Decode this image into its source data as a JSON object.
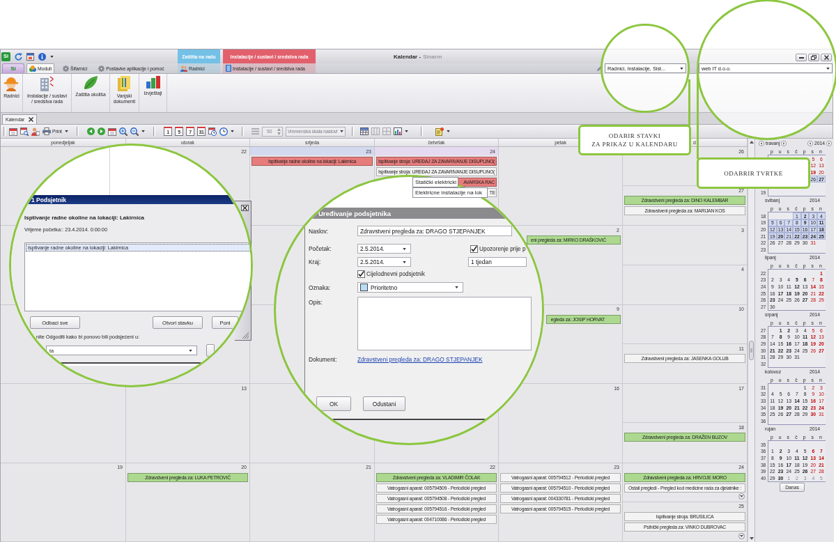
{
  "window": {
    "logo": "Si",
    "title": "Kalendar -",
    "app_name": "Sinarm"
  },
  "context_groups": [
    {
      "label": "Zaštita na radu",
      "color": "#74c0e6",
      "tabs": [
        {
          "label": "Radnici",
          "selected": false
        }
      ]
    },
    {
      "label": "Instalacije / sustavi / sredstva rada",
      "color": "#e2606c",
      "tabs": [
        {
          "label": "Instalacije / sustavi / sredstva rada",
          "selected": false
        }
      ]
    }
  ],
  "app_button": {
    "label": "Si"
  },
  "ribbon_tabs": [
    {
      "label": "Moduli",
      "selected": true
    },
    {
      "label": "Šifarnici",
      "selected": false
    },
    {
      "label": "Postavke aplikacije i pomoć",
      "selected": false
    }
  ],
  "filters": {
    "items": "Radnici, Instalacije, Sist...",
    "company": "web IT d.o.o."
  },
  "ribbon_buttons": [
    {
      "label": "Radnici"
    },
    {
      "label": "Instalacije / sustavi\n/ sredstva rada"
    },
    {
      "label": "Zaštita okoliša"
    },
    {
      "label": "Vanjski\ndokumenti"
    },
    {
      "label": "Izvještaji"
    }
  ],
  "document_tabs": [
    {
      "label": "Kalendar",
      "selected": true
    }
  ],
  "toolbar": {
    "print": "Print",
    "views": [
      "1",
      "5",
      "7",
      "31"
    ],
    "spin": {
      "value": "50",
      "disabled": true
    },
    "time_scale": {
      "value": "Vremenska skala naslovi",
      "disabled": true
    }
  },
  "calendar": {
    "columns": [
      "ponedjeljak",
      "utorak",
      "srijeda",
      "četvrtak",
      "petak",
      "d"
    ],
    "weeks": [
      {
        "tue": {
          "date": "22",
          "selected": false,
          "today": false,
          "more": false
        },
        "wed": {
          "date": "23",
          "selected": true,
          "today": false,
          "more": false,
          "events": [
            {
              "title": "Ispitivanje radne okoline na lokaciji: Lakirnica",
              "color": "#e77c7c"
            }
          ]
        },
        "thu": {
          "date": "24",
          "selected": false,
          "today": true,
          "more": false,
          "events": [
            {
              "title": "Ispitivanje stroja: UREĐAJ ZA ZAVARIVANJE DISUPLINO(",
              "color": "#e77c7c"
            },
            {
              "title": "Ispitivanje stroja: UREĐAJ ZA ZAVARIVANJE DISUPLINO(",
              "color": "#f3f3f3"
            },
            {
              "title": "AVARSKA RAC",
              "color": "#e77c7c"
            },
            {
              "title": "TE",
              "color": "#f3f3f3"
            }
          ]
        },
        "sat": {
          "date": "26",
          "selected": false,
          "today": false,
          "more": false
        },
        "sun": {
          "date": "27",
          "selected": false,
          "today": false,
          "more": false,
          "events": [
            {
              "title": "Zdravstveni pregleda za: DINO KALEMBAR",
              "color": "#acd98f"
            },
            {
              "title": "Zdravstveni pregleda za: MARIJAN KOS",
              "color": "#f3f3f3"
            }
          ]
        }
      },
      {
        "fri": {
          "date": "2",
          "selected": false,
          "today": false,
          "more": false,
          "events": [
            {
              "title": "eni pregleda za: MIRKO DRAŠKOVIĆ",
              "color": "#acd98f"
            }
          ]
        },
        "sat": {
          "date": "3",
          "selected": false,
          "today": false,
          "more": false
        },
        "sun": {
          "date": "4",
          "selected": false,
          "today": false,
          "more": false
        }
      },
      {
        "fri": {
          "date": "9",
          "selected": false,
          "today": false,
          "more": false,
          "events": [
            {
              "title": "egleda za: JOSIP HORVAT",
              "color": "#acd98f"
            }
          ]
        },
        "sat": {
          "date": "10",
          "selected": false,
          "today": false,
          "more": false
        },
        "sun": {
          "date": "11",
          "selected": false,
          "today": false,
          "more": false,
          "events": [
            {
              "title": "Zdravstveni pregleda za: JASENKA GOLUB",
              "color": "#f3f3f3"
            }
          ]
        }
      },
      {
        "tue": {
          "date": "13",
          "selected": false,
          "today": false,
          "more": false
        },
        "fri": {
          "date": "16",
          "selected": false,
          "today": false,
          "more": false
        },
        "sat": {
          "date": "17",
          "selected": false,
          "today": false,
          "more": false
        },
        "sun": {
          "date": "18",
          "selected": false,
          "today": false,
          "more": false,
          "events": [
            {
              "title": "Zdravstveni pregleda za: DRAŽEN BUZOV",
              "color": "#acd98f"
            }
          ]
        }
      },
      {
        "mon": {
          "date": "19",
          "selected": false,
          "today": false,
          "more": false
        },
        "tue": {
          "date": "20",
          "selected": false,
          "today": false,
          "more": false,
          "events": [
            {
              "title": "Zdravstveni pregleda za: LUKA PETROVIĆ",
              "color": "#acd98f"
            }
          ]
        },
        "wed": {
          "date": "21",
          "selected": false,
          "today": false,
          "more": false
        },
        "thu": {
          "date": "22",
          "selected": false,
          "today": false,
          "more": false,
          "events": [
            {
              "title": "Zdravstveni pregleda za: VLADIMIR ČOLAK",
              "color": "#acd98f"
            },
            {
              "title": "Vatrogasni aparat: 005794509 - Periodicki pregled",
              "color": "#f3f3f3"
            },
            {
              "title": "Vatrogasni aparat: 005794508 - Periodicki pregled",
              "color": "#f3f3f3"
            },
            {
              "title": "Vatrogasni aparat: 005794516 - Periodicki pregled",
              "color": "#f3f3f3"
            },
            {
              "title": "Vatrogasni aparat: 004710086 - Periodicki pregled",
              "color": "#f3f3f3"
            }
          ]
        },
        "fri": {
          "date": "23",
          "selected": false,
          "today": false,
          "more": false,
          "events": [
            {
              "title": "Vatrogasni aparat: 005794512 - Periodicki pregled",
              "color": "#f3f3f3"
            },
            {
              "title": "Vatrogasni aparat: 005794510 - Periodicki pregled",
              "color": "#f3f3f3"
            },
            {
              "title": "Vatrogasni aparat: 004330781 - Periodicki pregled",
              "color": "#f3f3f3"
            },
            {
              "title": "Vatrogasni aparat: 005794515 - Periodicki pregled",
              "color": "#f3f3f3"
            }
          ]
        },
        "sat": {
          "date": "24",
          "selected": false,
          "today": false,
          "more": true,
          "events": [
            {
              "title": "Zdravstveni pregleda za: HRVOJE MORO",
              "color": "#acd98f"
            },
            {
              "title": "Ostali pregledi - Pregled kod medicine rada za djelatnike :",
              "color": "#f3f3f3"
            }
          ]
        },
        "sun": {
          "date": "25",
          "selected": false,
          "today": false,
          "more": true,
          "events": [
            {
              "title": "Ispitivanje stroja: BRUSILICA",
              "color": "#f3f3f3"
            },
            {
              "title": "Psihički pregleda za: VINKO DUBROVAC",
              "color": "#f3f3f3"
            }
          ]
        }
      }
    ]
  },
  "mini_calendars": [
    {
      "name": "travanj",
      "year": "2014",
      "day_names": [
        "p",
        "u",
        "s",
        "č",
        "p",
        "s",
        "n"
      ],
      "weeks": [
        {
          "sat": {
            "day": "5",
            "has_events": false,
            "selected": false,
            "other_month": false
          },
          "sun": {
            "day": "6",
            "has_events": false,
            "selected": false,
            "other_month": false
          }
        },
        {
          "sat": {
            "day": "12",
            "has_events": false,
            "selected": false,
            "other_month": false
          },
          "sun": {
            "day": "13",
            "has_events": false,
            "selected": false,
            "other_month": false
          }
        },
        {
          "sat": {
            "day": "19",
            "has_events": true,
            "selected": false,
            "other_month": false
          },
          "sun": {
            "day": "20",
            "has_events": false,
            "selected": false,
            "other_month": false
          }
        },
        {
          "sat": {
            "day": "26",
            "has_events": false,
            "selected": true,
            "other_month": false
          },
          "sun": {
            "day": "27",
            "has_events": true,
            "selected": true,
            "other_month": false
          }
        },
        {
          "week": "19"
        }
      ]
    },
    {
      "name": "svibanj",
      "year": "2014",
      "day_names": [
        "p",
        "u",
        "s",
        "č",
        "p",
        "s",
        "n"
      ],
      "weeks": [
        {
          "week": "18",
          "thu": {
            "day": "1",
            "has_events": false,
            "selected": true,
            "other_month": false
          },
          "fri": {
            "day": "2",
            "has_events": true,
            "selected": true,
            "other_month": false
          },
          "sat": {
            "day": "3",
            "has_events": false,
            "selected": true,
            "other_month": false
          },
          "sun": {
            "day": "4",
            "has_events": false,
            "selected": true,
            "other_month": false
          }
        },
        {
          "week": "19",
          "mon": {
            "day": "5",
            "has_events": false,
            "selected": true,
            "other_month": false
          },
          "tue": {
            "day": "6",
            "has_events": false,
            "selected": true,
            "other_month": false
          },
          "wed": {
            "day": "7",
            "has_events": false,
            "selected": true,
            "other_month": false
          },
          "thu": {
            "day": "8",
            "has_events": false,
            "selected": true,
            "other_month": false
          },
          "fri": {
            "day": "9",
            "has_events": true,
            "selected": true,
            "other_month": false
          },
          "sat": {
            "day": "10",
            "has_events": false,
            "selected": true,
            "other_month": false
          },
          "sun": {
            "day": "11",
            "has_events": true,
            "selected": true,
            "other_month": false
          }
        },
        {
          "week": "20",
          "mon": {
            "day": "12",
            "has_events": false,
            "selected": true,
            "other_month": false
          },
          "tue": {
            "day": "13",
            "has_events": false,
            "selected": true,
            "other_month": false
          },
          "wed": {
            "day": "14",
            "has_events": false,
            "selected": true,
            "other_month": false
          },
          "thu": {
            "day": "15",
            "has_events": false,
            "selected": true,
            "other_month": false
          },
          "fri": {
            "day": "16",
            "has_events": false,
            "selected": true,
            "other_month": false
          },
          "sat": {
            "day": "17",
            "has_events": false,
            "selected": true,
            "other_month": false
          },
          "sun": {
            "day": "18",
            "has_events": true,
            "selected": true,
            "other_month": false
          }
        },
        {
          "week": "21",
          "mon": {
            "day": "19",
            "has_events": false,
            "selected": true,
            "other_month": false
          },
          "tue": {
            "day": "20",
            "has_events": true,
            "selected": true,
            "other_month": false
          },
          "wed": {
            "day": "21",
            "has_events": false,
            "selected": true,
            "other_month": false
          },
          "thu": {
            "day": "22",
            "has_events": true,
            "selected": true,
            "other_month": false
          },
          "fri": {
            "day": "23",
            "has_events": true,
            "selected": true,
            "other_month": false
          },
          "sat": {
            "day": "24",
            "has_events": true,
            "selected": true,
            "other_month": false
          },
          "sun": {
            "day": "25",
            "has_events": true,
            "selected": true,
            "other_month": false
          }
        },
        {
          "week": "22",
          "mon": {
            "day": "26",
            "has_events": false,
            "selected": false,
            "other_month": false
          },
          "tue": {
            "day": "27",
            "has_events": false,
            "selected": false,
            "other_month": false
          },
          "wed": {
            "day": "28",
            "has_events": false,
            "selected": false,
            "other_month": false
          },
          "thu": {
            "day": "29",
            "has_events": false,
            "selected": false,
            "other_month": false
          },
          "fri": {
            "day": "30",
            "has_events": false,
            "selected": false,
            "other_month": false
          },
          "sat": {
            "day": "31",
            "has_events": false,
            "selected": false,
            "other_month": false
          }
        },
        {
          "week": "23"
        }
      ]
    },
    {
      "name": "lipanj",
      "year": "2014",
      "day_names": [
        "p",
        "u",
        "s",
        "č",
        "p",
        "s",
        "n"
      ],
      "weeks": [
        {
          "week": "22",
          "sun": {
            "day": "1",
            "has_events": true,
            "selected": false,
            "other_month": false
          }
        },
        {
          "week": "23",
          "mon": {
            "day": "2",
            "has_events": false,
            "selected": false,
            "other_month": false
          },
          "tue": {
            "day": "3",
            "has_events": false,
            "selected": false,
            "other_month": false
          },
          "wed": {
            "day": "4",
            "has_events": false,
            "selected": false,
            "other_month": false
          },
          "thu": {
            "day": "5",
            "has_events": true,
            "selected": false,
            "other_month": false
          },
          "fri": {
            "day": "6",
            "has_events": true,
            "selected": false,
            "other_month": false
          },
          "sat": {
            "day": "7",
            "has_events": false,
            "selected": false,
            "other_month": false
          },
          "sun": {
            "day": "8",
            "has_events": true,
            "selected": false,
            "other_month": false
          }
        },
        {
          "week": "24",
          "mon": {
            "day": "9",
            "has_events": false,
            "selected": false,
            "other_month": false
          },
          "tue": {
            "day": "10",
            "has_events": false,
            "selected": false,
            "other_month": false
          },
          "wed": {
            "day": "11",
            "has_events": false,
            "selected": false,
            "other_month": false
          },
          "thu": {
            "day": "12",
            "has_events": true,
            "selected": false,
            "other_month": false
          },
          "fri": {
            "day": "13",
            "has_events": false,
            "selected": false,
            "other_month": false
          },
          "sat": {
            "day": "14",
            "has_events": true,
            "selected": false,
            "other_month": false
          },
          "sun": {
            "day": "15",
            "has_events": false,
            "selected": false,
            "other_month": false
          }
        },
        {
          "week": "25",
          "mon": {
            "day": "16",
            "has_events": false,
            "selected": false,
            "other_month": false
          },
          "tue": {
            "day": "17",
            "has_events": true,
            "selected": false,
            "other_month": false
          },
          "wed": {
            "day": "18",
            "has_events": true,
            "selected": false,
            "other_month": false
          },
          "thu": {
            "day": "19",
            "has_events": true,
            "selected": false,
            "other_month": false
          },
          "fri": {
            "day": "20",
            "has_events": true,
            "selected": false,
            "other_month": false
          },
          "sat": {
            "day": "21",
            "has_events": false,
            "selected": false,
            "other_month": false
          },
          "sun": {
            "day": "22",
            "has_events": true,
            "selected": false,
            "other_month": false
          }
        },
        {
          "week": "26",
          "mon": {
            "day": "23",
            "has_events": true,
            "selected": false,
            "other_month": false
          },
          "tue": {
            "day": "24",
            "has_events": false,
            "selected": false,
            "other_month": false
          },
          "wed": {
            "day": "25",
            "has_events": false,
            "selected": false,
            "other_month": false
          },
          "thu": {
            "day": "26",
            "has_events": false,
            "selected": false,
            "other_month": false
          },
          "fri": {
            "day": "27",
            "has_events": true,
            "selected": false,
            "other_month": false
          },
          "sat": {
            "day": "28",
            "has_events": false,
            "selected": false,
            "other_month": false
          },
          "sun": {
            "day": "29",
            "has_events": false,
            "selected": false,
            "other_month": false
          }
        },
        {
          "week": "27",
          "mon": {
            "day": "30",
            "has_events": false,
            "selected": false,
            "other_month": false
          }
        }
      ]
    },
    {
      "name": "srpanj",
      "year": "2014",
      "day_names": [
        "p",
        "u",
        "s",
        "č",
        "p",
        "s",
        "n"
      ],
      "weeks": [
        {
          "week": "27",
          "tue": {
            "day": "1",
            "has_events": true,
            "selected": false,
            "other_month": false
          },
          "wed": {
            "day": "2",
            "has_events": true,
            "selected": false,
            "other_month": false
          },
          "thu": {
            "day": "3",
            "has_events": false,
            "selected": false,
            "other_month": false
          },
          "fri": {
            "day": "4",
            "has_events": false,
            "selected": false,
            "other_month": false
          },
          "sat": {
            "day": "5",
            "has_events": false,
            "selected": false,
            "other_month": false
          },
          "sun": {
            "day": "6",
            "has_events": false,
            "selected": false,
            "other_month": false
          }
        },
        {
          "week": "28",
          "mon": {
            "day": "7",
            "has_events": false,
            "selected": false,
            "other_month": false
          },
          "tue": {
            "day": "8",
            "has_events": true,
            "selected": false,
            "other_month": false
          },
          "wed": {
            "day": "9",
            "has_events": false,
            "selected": false,
            "other_month": false
          },
          "thu": {
            "day": "10",
            "has_events": false,
            "selected": false,
            "other_month": false
          },
          "fri": {
            "day": "11",
            "has_events": true,
            "selected": false,
            "other_month": false
          },
          "sat": {
            "day": "12",
            "has_events": true,
            "selected": false,
            "other_month": false
          },
          "sun": {
            "day": "13",
            "has_events": false,
            "selected": false,
            "other_month": false
          }
        },
        {
          "week": "29",
          "mon": {
            "day": "14",
            "has_events": false,
            "selected": false,
            "other_month": false
          },
          "tue": {
            "day": "15",
            "has_events": false,
            "selected": false,
            "other_month": false
          },
          "wed": {
            "day": "16",
            "has_events": true,
            "selected": false,
            "other_month": false
          },
          "thu": {
            "day": "17",
            "has_events": false,
            "selected": false,
            "other_month": false
          },
          "fri": {
            "day": "18",
            "has_events": true,
            "selected": false,
            "other_month": false
          },
          "sat": {
            "day": "19",
            "has_events": true,
            "selected": false,
            "other_month": false
          },
          "sun": {
            "day": "20",
            "has_events": true,
            "selected": false,
            "other_month": false
          }
        },
        {
          "week": "30",
          "mon": {
            "day": "21",
            "has_events": true,
            "selected": false,
            "other_month": false
          },
          "tue": {
            "day": "22",
            "has_events": true,
            "selected": false,
            "other_month": false
          },
          "wed": {
            "day": "23",
            "has_events": true,
            "selected": false,
            "other_month": false
          },
          "thu": {
            "day": "24",
            "has_events": false,
            "selected": false,
            "other_month": false
          },
          "fri": {
            "day": "25",
            "has_events": false,
            "selected": false,
            "other_month": false
          },
          "sat": {
            "day": "26",
            "has_events": false,
            "selected": false,
            "other_month": false
          },
          "sun": {
            "day": "27",
            "has_events": true,
            "selected": false,
            "other_month": false
          }
        },
        {
          "week": "31",
          "mon": {
            "day": "28",
            "has_events": false,
            "selected": false,
            "other_month": false
          },
          "tue": {
            "day": "29",
            "has_events": false,
            "selected": false,
            "other_month": false
          },
          "wed": {
            "day": "30",
            "has_events": false,
            "selected": false,
            "other_month": false
          },
          "thu": {
            "day": "31",
            "has_events": false,
            "selected": false,
            "other_month": false
          }
        },
        {
          "week": "32"
        }
      ]
    },
    {
      "name": "kolovoz",
      "year": "2014",
      "day_names": [
        "p",
        "u",
        "s",
        "č",
        "p",
        "s",
        "n"
      ],
      "weeks": [
        {
          "week": "31",
          "fri": {
            "day": "1",
            "has_events": false,
            "selected": false,
            "other_month": false
          },
          "sat": {
            "day": "2",
            "has_events": false,
            "selected": false,
            "other_month": false
          },
          "sun": {
            "day": "3",
            "has_events": false,
            "selected": false,
            "other_month": false
          }
        },
        {
          "week": "32",
          "mon": {
            "day": "4",
            "has_events": false,
            "selected": false,
            "other_month": false
          },
          "tue": {
            "day": "5",
            "has_events": false,
            "selected": false,
            "other_month": false
          },
          "wed": {
            "day": "6",
            "has_events": false,
            "selected": false,
            "other_month": false
          },
          "thu": {
            "day": "7",
            "has_events": false,
            "selected": false,
            "other_month": false
          },
          "fri": {
            "day": "8",
            "has_events": false,
            "selected": false,
            "other_month": false
          },
          "sat": {
            "day": "9",
            "has_events": false,
            "selected": false,
            "other_month": false
          },
          "sun": {
            "day": "10",
            "has_events": false,
            "selected": false,
            "other_month": false
          }
        },
        {
          "week": "33",
          "mon": {
            "day": "11",
            "has_events": false,
            "selected": false,
            "other_month": false
          },
          "tue": {
            "day": "12",
            "has_events": false,
            "selected": false,
            "other_month": false
          },
          "wed": {
            "day": "13",
            "has_events": false,
            "selected": false,
            "other_month": false
          },
          "thu": {
            "day": "14",
            "has_events": true,
            "selected": false,
            "other_month": false
          },
          "fri": {
            "day": "15",
            "has_events": false,
            "selected": false,
            "other_month": false
          },
          "sat": {
            "day": "16",
            "has_events": true,
            "selected": false,
            "other_month": false
          },
          "sun": {
            "day": "17",
            "has_events": false,
            "selected": false,
            "other_month": false
          }
        },
        {
          "week": "34",
          "mon": {
            "day": "18",
            "has_events": false,
            "selected": false,
            "other_month": false
          },
          "tue": {
            "day": "19",
            "has_events": true,
            "selected": false,
            "other_month": false
          },
          "wed": {
            "day": "20",
            "has_events": true,
            "selected": false,
            "other_month": false
          },
          "thu": {
            "day": "21",
            "has_events": true,
            "selected": false,
            "other_month": false
          },
          "fri": {
            "day": "22",
            "has_events": true,
            "selected": false,
            "other_month": false
          },
          "sat": {
            "day": "23",
            "has_events": true,
            "selected": false,
            "other_month": false
          },
          "sun": {
            "day": "24",
            "has_events": true,
            "selected": false,
            "other_month": false
          }
        },
        {
          "week": "35",
          "mon": {
            "day": "25",
            "has_events": false,
            "selected": false,
            "other_month": false
          },
          "tue": {
            "day": "26",
            "has_events": false,
            "selected": false,
            "other_month": false
          },
          "wed": {
            "day": "27",
            "has_events": true,
            "selected": false,
            "other_month": false
          },
          "thu": {
            "day": "28",
            "has_events": false,
            "selected": false,
            "other_month": false
          },
          "fri": {
            "day": "29",
            "has_events": false,
            "selected": false,
            "other_month": false
          },
          "sat": {
            "day": "30",
            "has_events": true,
            "selected": false,
            "other_month": false
          },
          "sun": {
            "day": "31",
            "has_events": false,
            "selected": false,
            "other_month": false
          }
        },
        {
          "week": "36"
        }
      ]
    },
    {
      "name": "rujan",
      "year": "2014",
      "day_names": [
        "p",
        "u",
        "s",
        "č",
        "p",
        "s",
        "n"
      ],
      "weeks": [
        {
          "week": "35"
        },
        {
          "week": "36",
          "mon": {
            "day": "1",
            "has_events": false,
            "selected": false,
            "other_month": false
          },
          "tue": {
            "day": "2",
            "has_events": true,
            "selected": false,
            "other_month": false
          },
          "wed": {
            "day": "3",
            "has_events": false,
            "selected": false,
            "other_month": false
          },
          "thu": {
            "day": "4",
            "has_events": false,
            "selected": false,
            "other_month": false
          },
          "fri": {
            "day": "5",
            "has_events": false,
            "selected": false,
            "other_month": false
          },
          "sat": {
            "day": "6",
            "has_events": true,
            "selected": false,
            "other_month": false
          },
          "sun": {
            "day": "7",
            "has_events": true,
            "selected": false,
            "other_month": false
          }
        },
        {
          "week": "37",
          "mon": {
            "day": "8",
            "has_events": false,
            "selected": false,
            "other_month": false
          },
          "tue": {
            "day": "9",
            "has_events": true,
            "selected": false,
            "other_month": false
          },
          "wed": {
            "day": "10",
            "has_events": false,
            "selected": false,
            "other_month": false
          },
          "thu": {
            "day": "11",
            "has_events": true,
            "selected": false,
            "other_month": false
          },
          "fri": {
            "day": "12",
            "has_events": true,
            "selected": false,
            "other_month": false
          },
          "sat": {
            "day": "13",
            "has_events": true,
            "selected": false,
            "other_month": false
          },
          "sun": {
            "day": "14",
            "has_events": true,
            "selected": false,
            "other_month": false
          }
        },
        {
          "week": "38",
          "mon": {
            "day": "15",
            "has_events": false,
            "selected": false,
            "other_month": false
          },
          "tue": {
            "day": "16",
            "has_events": false,
            "selected": false,
            "other_month": false
          },
          "wed": {
            "day": "17",
            "has_events": true,
            "selected": false,
            "other_month": false
          },
          "thu": {
            "day": "18",
            "has_events": false,
            "selected": false,
            "other_month": false
          },
          "fri": {
            "day": "19",
            "has_events": false,
            "selected": false,
            "other_month": false
          },
          "sat": {
            "day": "20",
            "has_events": false,
            "selected": false,
            "other_month": false
          },
          "sun": {
            "day": "21",
            "has_events": true,
            "selected": false,
            "other_month": false
          }
        },
        {
          "week": "39",
          "mon": {
            "day": "22",
            "has_events": false,
            "selected": false,
            "other_month": false
          },
          "tue": {
            "day": "23",
            "has_events": true,
            "selected": false,
            "other_month": false
          },
          "wed": {
            "day": "24",
            "has_events": false,
            "selected": false,
            "other_month": false
          },
          "thu": {
            "day": "25",
            "has_events": false,
            "selected": false,
            "other_month": false
          },
          "fri": {
            "day": "26",
            "has_events": true,
            "selected": false,
            "other_month": false
          },
          "sat": {
            "day": "27",
            "has_events": false,
            "selected": false,
            "other_month": false
          },
          "sun": {
            "day": "28",
            "has_events": false,
            "selected": false,
            "other_month": false
          }
        },
        {
          "week": "40",
          "mon": {
            "day": "29",
            "has_events": false,
            "selected": false,
            "other_month": false
          },
          "tue": {
            "day": "30",
            "has_events": true,
            "selected": false,
            "other_month": false
          },
          "wed": {
            "day": "1",
            "has_events": false,
            "selected": false,
            "other_month": true
          },
          "thu": {
            "day": "2",
            "has_events": false,
            "selected": false,
            "other_month": true
          },
          "fri": {
            "day": "3",
            "has_events": false,
            "selected": false,
            "other_month": true
          },
          "sat": {
            "day": "4",
            "has_events": false,
            "selected": false,
            "other_month": true
          },
          "sun": {
            "day": "5",
            "has_events": false,
            "selected": false,
            "other_month": true
          }
        }
      ]
    }
  ],
  "today_button": "Danas",
  "reminder_popup": {
    "title": "1 Podsjetnik",
    "subject": "Isptivanje radne okoline na lokaciji: Lakirnica",
    "start_time": "Vrijeme početka:: 23.4.2014. 0:00:00",
    "items": [
      {
        "label": "Isptivanje radne okoline na lokaciji: Lakirnica",
        "selected": true
      }
    ],
    "buttons": [
      "Odbaci sve",
      "Otvori stavku",
      "Poni"
    ],
    "snooze_prompt": "nite Odgoditi kako bi ponovo bili podsjećeni u:",
    "snooze_time": "ta"
  },
  "event_popup": [
    "Statički elektricki",
    "Elektricne instalacije na lok"
  ],
  "reminder_editor": {
    "title": "Uređivanje podsjetnika",
    "subject_label": "Naslov:",
    "subject": "Zdravstveni pregleda za: DRAGO STJEPANJEK",
    "start_label": "Početak:",
    "start": "2.5.2014.",
    "end_label": "Kraj:",
    "end": "2.5.2014.",
    "alert": {
      "label": "Upozorenje prije p",
      "checked": true
    },
    "alert_time": "1 tjedan",
    "all_day": {
      "label": "Cijelodnevni podsjetnik",
      "checked": true
    },
    "tag_label": "Oznaka:",
    "tag": "Prioritetno",
    "description_label": "Opis:",
    "document_label": "Dokument:",
    "document": "Zdravstveni pregleda za: DRAGO STJEPANJEK",
    "buttons": [
      "OK",
      "Odustani"
    ]
  },
  "callouts": [
    {
      "text": "ODABIR STAVKI\nZA PRIKAZ U KALENDARU"
    },
    {
      "text": "ODABRIR TVRTKE"
    }
  ]
}
